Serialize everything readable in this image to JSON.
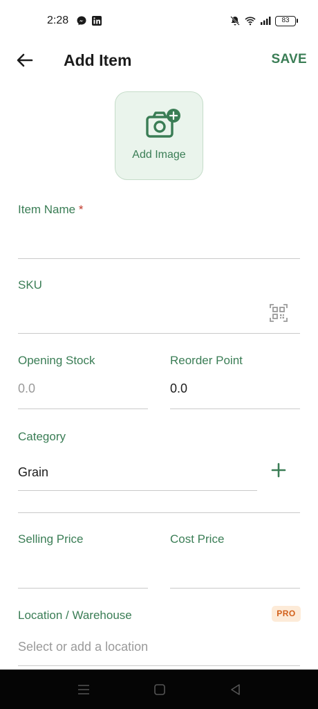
{
  "status_bar": {
    "time": "2:28",
    "battery": "83"
  },
  "app_bar": {
    "title": "Add Item",
    "save_label": "SAVE"
  },
  "add_image": {
    "label": "Add Image"
  },
  "form": {
    "item_name": {
      "label": "Item Name",
      "required_mark": "*",
      "value": ""
    },
    "sku": {
      "label": "SKU",
      "value": ""
    },
    "opening_stock": {
      "label": "Opening Stock",
      "placeholder": "0.0"
    },
    "reorder_point": {
      "label": "Reorder Point",
      "value": "0.0"
    },
    "category": {
      "label": "Category",
      "value": "Grain"
    },
    "selling_price": {
      "label": "Selling Price",
      "value": ""
    },
    "cost_price": {
      "label": "Cost Price",
      "value": ""
    },
    "location": {
      "label": "Location / Warehouse",
      "placeholder": "Select or add a location",
      "badge": "PRO"
    }
  },
  "colors": {
    "accent": "#3a7d55",
    "required": "#c0392b",
    "pro_badge_bg": "#fdebd8",
    "pro_badge_text": "#d2601a"
  },
  "icons": [
    "back-arrow-icon",
    "camera-plus-icon",
    "qr-scan-icon",
    "plus-icon",
    "recents-icon",
    "home-icon",
    "back-triangle-icon",
    "messenger-icon",
    "linkedin-icon",
    "mute-icon",
    "wifi-icon",
    "signal-icon",
    "battery-icon"
  ]
}
